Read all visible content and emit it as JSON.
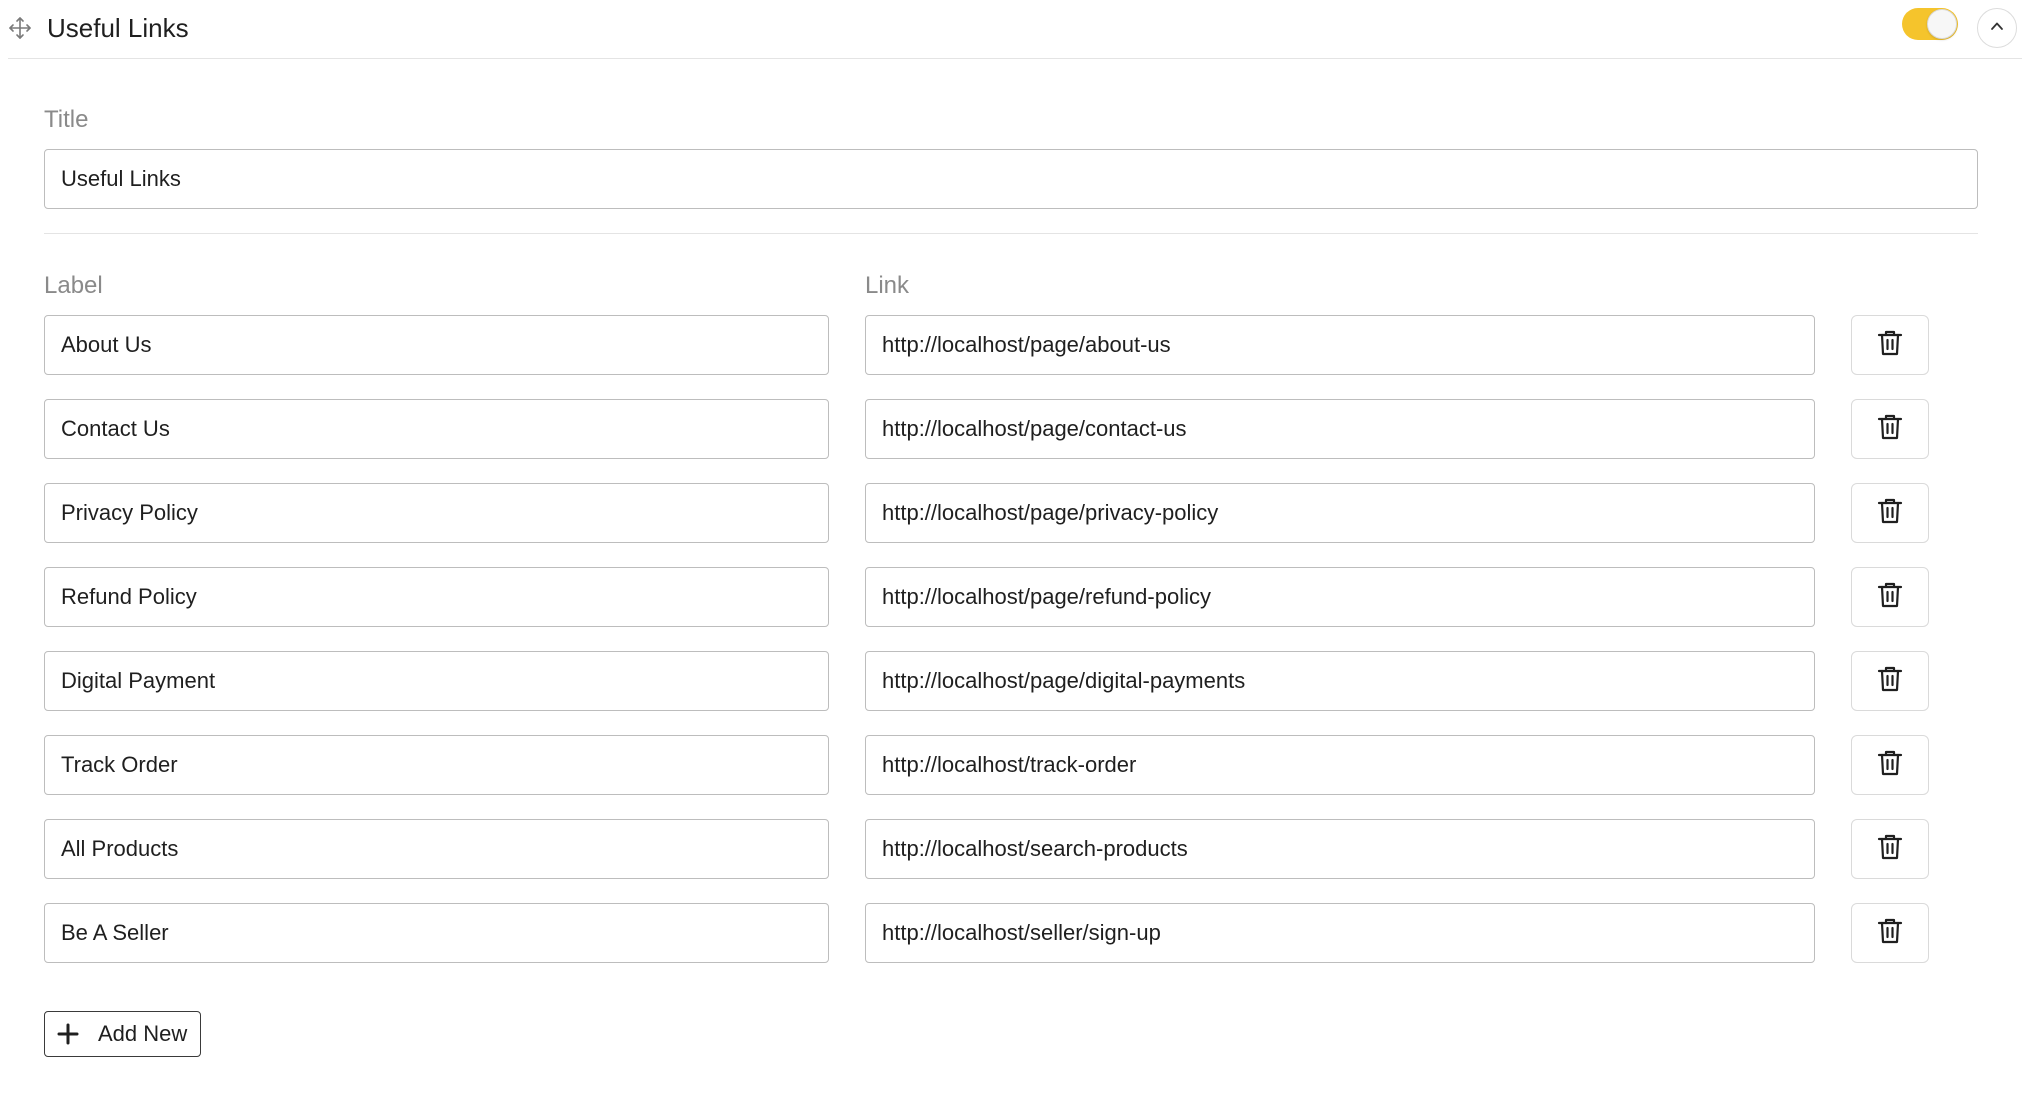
{
  "header": {
    "title": "Useful Links",
    "enabled": true,
    "icons": {
      "drag": "move-icon",
      "collapse": "chevron-up-icon"
    }
  },
  "title_field": {
    "label": "Title",
    "value": "Useful Links"
  },
  "columns": {
    "label": "Label",
    "link": "Link"
  },
  "links": [
    {
      "label": "About Us",
      "link": "http://localhost/page/about-us"
    },
    {
      "label": "Contact Us",
      "link": "http://localhost/page/contact-us"
    },
    {
      "label": "Privacy Policy",
      "link": "http://localhost/page/privacy-policy"
    },
    {
      "label": "Refund Policy",
      "link": "http://localhost/page/refund-policy"
    },
    {
      "label": "Digital Payment",
      "link": "http://localhost/page/digital-payments"
    },
    {
      "label": "Track Order",
      "link": "http://localhost/track-order"
    },
    {
      "label": "All Products",
      "link": "http://localhost/search-products"
    },
    {
      "label": "Be A Seller",
      "link": "http://localhost/seller/sign-up"
    }
  ],
  "row_icon": "trash-icon",
  "add_button": {
    "label": "Add New",
    "icon": "plus-icon"
  },
  "colors": {
    "toggle_on": "#f5c42c",
    "border": "#bdbdbd",
    "muted_label": "#8a8a8a"
  }
}
